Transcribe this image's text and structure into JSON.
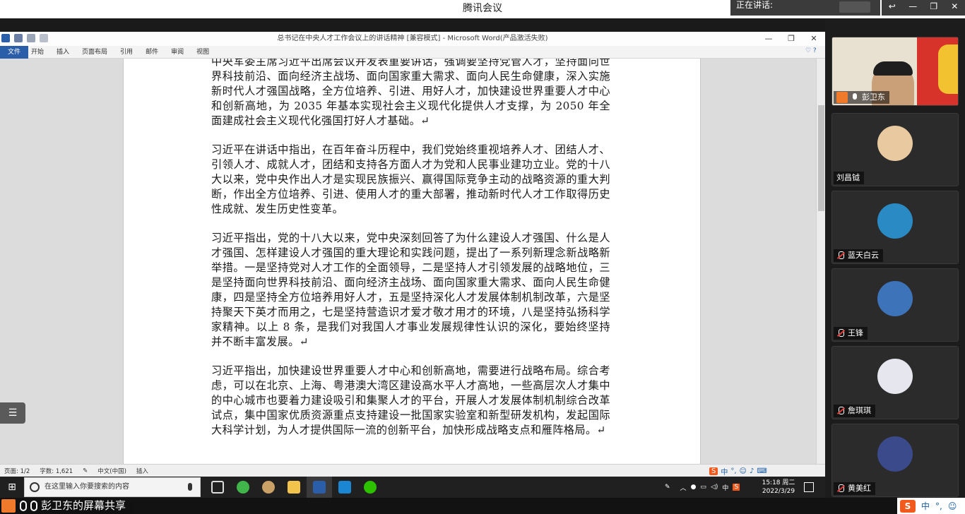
{
  "meeting": {
    "app_title": "腾讯会议",
    "speaking_label": "正在讲话:",
    "window_controls": [
      "↩",
      "—",
      "❐",
      "✕"
    ]
  },
  "word": {
    "title": "总书记在中央人才工作会议上的讲话精神 [兼容模式] - Microsoft Word(产品激活失败)",
    "window_controls": [
      "—",
      "❐",
      "✕"
    ],
    "file_tab": "文件",
    "tabs": [
      "开始",
      "插入",
      "页面布局",
      "引用",
      "邮件",
      "审阅",
      "视图"
    ],
    "paragraphs": [
      "中央军委主席习近平出席会议并发表重要讲话，强调要坚持党管人才，坚持面向世界科技前沿、面向经济主战场、面向国家重大需求、面向人民生命健康，深入实施新时代人才强国战略，全方位培养、引进、用好人才，加快建设世界重要人才中心和创新高地，为 2035 年基本实现社会主义现代化提供人才支撑，为 2050 年全面建成社会主义现代化强国打好人才基础。↵",
      "习近平在讲话中指出，在百年奋斗历程中，我们党始终重视培养人才、团结人才、引领人才、成就人才，团结和支持各方面人才为党和人民事业建功立业。党的十八大以来，党中央作出人才是实现民族振兴、赢得国际竞争主动的战略资源的重大判断，作出全方位培养、引进、使用人才的重大部署，推动新时代人才工作取得历史性成就、发生历史性变革。",
      "习近平指出，党的十八大以来，党中央深刻回答了为什么建设人才强国、什么是人才强国、怎样建设人才强国的重大理论和实践问题，提出了一系列新理念新战略新举措。一是坚持党对人才工作的全面领导，二是坚持人才引领发展的战略地位，三是坚持面向世界科技前沿、面向经济主战场、面向国家重大需求、面向人民生命健康，四是坚持全方位培养用好人才，五是坚持深化人才发展体制机制改革，六是坚持聚天下英才而用之，七是坚持营造识才爱才敬才用才的环境，八是坚持弘扬科学家精神。以上 8 条，是我们对我国人才事业发展规律性认识的深化，要始终坚持并不断丰富发展。↵",
      "习近平指出，加快建设世界重要人才中心和创新高地，需要进行战略布局。综合考虑，可以在北京、上海、粤港澳大湾区建设高水平人才高地，一些高层次人才集中的中心城市也要着力建设吸引和集聚人才的平台，开展人才发展体制机制综合改革试点，集中国家优质资源重点支持建设一批国家实验室和新型研发机构，发起国际大科学计划，为人才提供国际一流的创新平台，加快形成战略支点和雁阵格局。↵"
    ],
    "status": {
      "page": "页面: 1/2",
      "words": "字数: 1,621",
      "lang": "中文(中国)",
      "mode": "插入"
    }
  },
  "taskbar": {
    "search_placeholder": "在这里输入你要搜索的内容",
    "tray_ime": "中",
    "time": "15:18 周二",
    "date": "2022/3/29"
  },
  "share": {
    "label": "彭卫东的屏幕共享"
  },
  "ime": {
    "logo": "S",
    "lang": "中",
    "punct": "°,"
  },
  "participants": [
    {
      "name": "彭卫东",
      "video": true,
      "muted": false,
      "host": true
    },
    {
      "name": "刘昌钺",
      "video": false,
      "muted": false,
      "avatar_color": "#e8c9a0"
    },
    {
      "name": "蓝天白云",
      "video": false,
      "muted": true,
      "avatar_color": "#2a8ac4"
    },
    {
      "name": "王锋",
      "video": false,
      "muted": true,
      "avatar_color": "#3d73b8"
    },
    {
      "name": "詹琪琪",
      "video": false,
      "muted": true,
      "avatar_color": "#e6e6ee"
    },
    {
      "name": "黄美红",
      "video": false,
      "muted": true,
      "avatar_color": "#3b4a8a"
    }
  ]
}
